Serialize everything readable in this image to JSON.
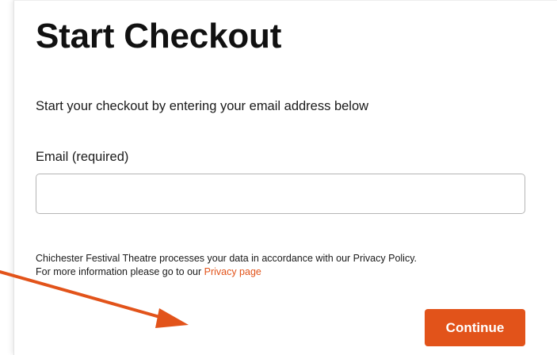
{
  "page": {
    "title": "Start Checkout",
    "intro": "Start your checkout by entering your email address below"
  },
  "form": {
    "email_label": "Email (required)",
    "email_value": "",
    "email_placeholder": ""
  },
  "notice": {
    "line1": "Chichester Festival Theatre processes your data in accordance with our Privacy Policy.",
    "line2_prefix": "For more information please go to our ",
    "privacy_link": "Privacy page"
  },
  "actions": {
    "continue_label": "Continue"
  },
  "colors": {
    "accent": "#e2531a",
    "annotation_arrow": "#e2531a"
  },
  "annotation": {
    "icon": "arrow-pointer-icon"
  }
}
